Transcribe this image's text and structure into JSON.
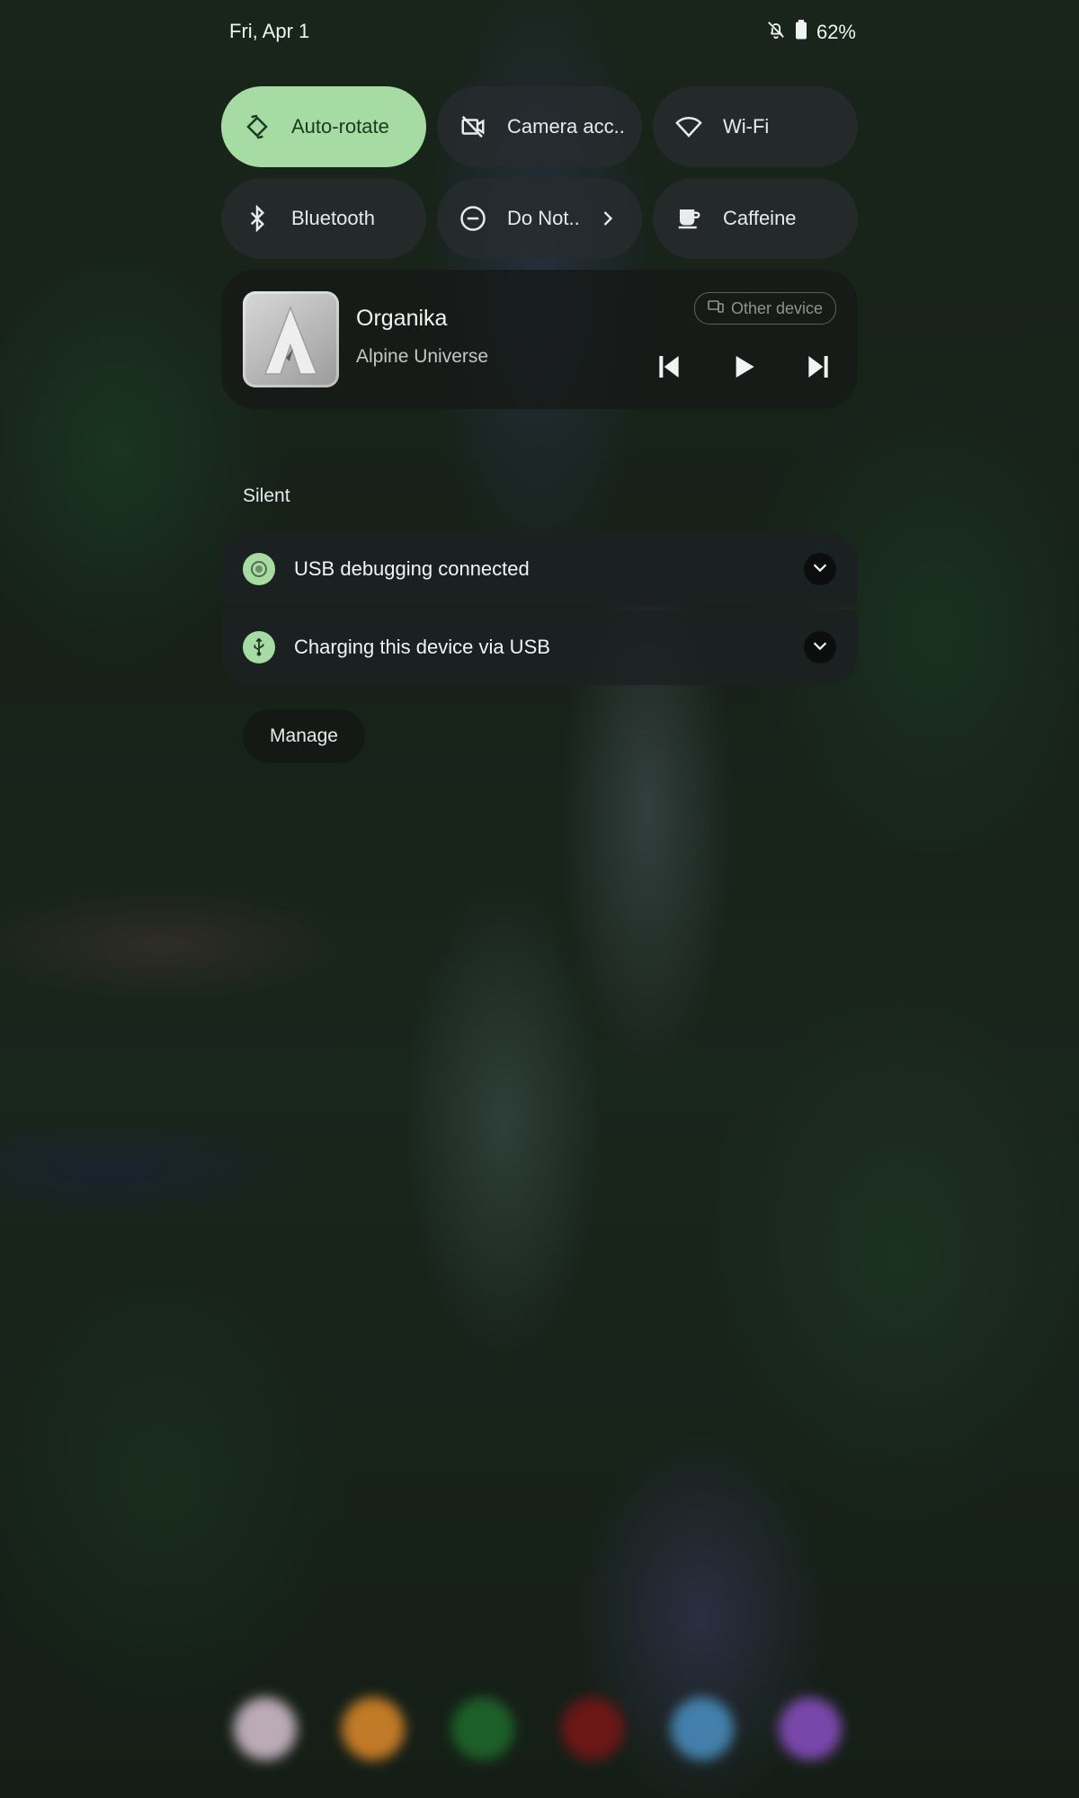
{
  "status_bar": {
    "date": "Fri, Apr 1",
    "battery_percent": "62%",
    "icons": [
      "notifications-off-icon",
      "battery-icon"
    ]
  },
  "quick_settings": {
    "tiles": [
      {
        "label": "Auto-rotate",
        "icon": "auto-rotate-icon",
        "active": true
      },
      {
        "label": "Camera acc..",
        "icon": "camera-off-icon",
        "active": false
      },
      {
        "label": "Wi-Fi",
        "icon": "wifi-icon",
        "active": false
      },
      {
        "label": "Bluetooth",
        "icon": "bluetooth-icon",
        "active": false
      },
      {
        "label": "Do Not..",
        "icon": "do-not-disturb-icon",
        "active": false,
        "has_chevron": true
      },
      {
        "label": "Caffeine",
        "icon": "coffee-cup-icon",
        "active": false
      }
    ]
  },
  "media": {
    "title": "Organika",
    "artist": "Alpine Universe",
    "output_device": "Other device",
    "controls": [
      "previous-icon",
      "play-icon",
      "next-icon"
    ]
  },
  "notifications": {
    "section_label": "Silent",
    "items": [
      {
        "text": "USB debugging connected",
        "icon": "usb-debug-icon"
      },
      {
        "text": "Charging this device via USB",
        "icon": "usb-icon"
      }
    ],
    "manage_label": "Manage"
  },
  "colors": {
    "active_tile": "#a6dba3",
    "tile_bg": "#2a2d30",
    "accent_green": "#a6dba3"
  },
  "dock": {
    "icon_colors": [
      "#d9c3d3",
      "#e08a2a",
      "#1f6b2c",
      "#7a1616",
      "#4a90c2",
      "#8b4fc4"
    ]
  }
}
